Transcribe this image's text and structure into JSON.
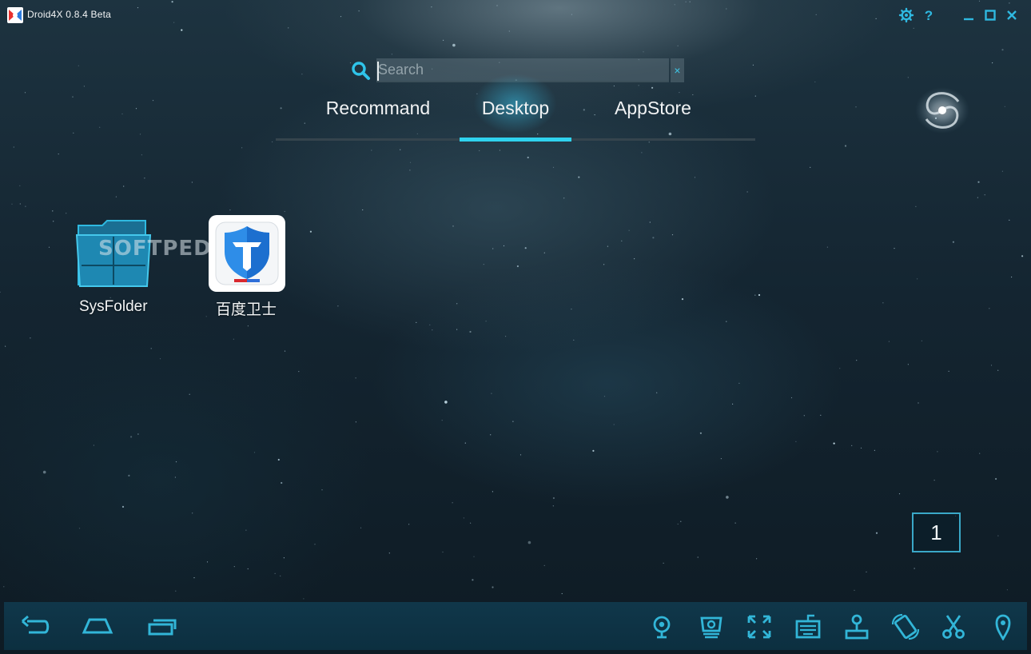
{
  "window": {
    "title": "Droid4X 0.8.4 Beta"
  },
  "search": {
    "placeholder": "Search",
    "value": "",
    "clear_symbol": "×"
  },
  "tabs": [
    {
      "label": "Recommand",
      "active": false
    },
    {
      "label": "Desktop",
      "active": true
    },
    {
      "label": "AppStore",
      "active": false
    }
  ],
  "desktop": {
    "apps": [
      {
        "label": "SysFolder",
        "icon": "folder-icon"
      },
      {
        "label": "百度卫士",
        "icon": "baidu-security-shield-icon"
      }
    ],
    "watermark": "SOFTPED",
    "page_number": "1"
  },
  "titlebar_controls": [
    "settings-icon",
    "help-icon",
    "minimize-icon",
    "maximize-icon",
    "close-icon"
  ],
  "bottombar": {
    "nav": [
      "back-icon",
      "home-icon",
      "recent-apps-icon"
    ],
    "tools": [
      "camera-icon",
      "screenshot-icon",
      "fullscreen-icon",
      "keyboard-icon",
      "joystick-icon",
      "rotate-icon",
      "scissors-icon",
      "location-icon"
    ]
  },
  "colors": {
    "accent": "#2fd2ee",
    "icon": "#32b6d8",
    "bottombar": "#0e3446",
    "background": "#142531"
  }
}
